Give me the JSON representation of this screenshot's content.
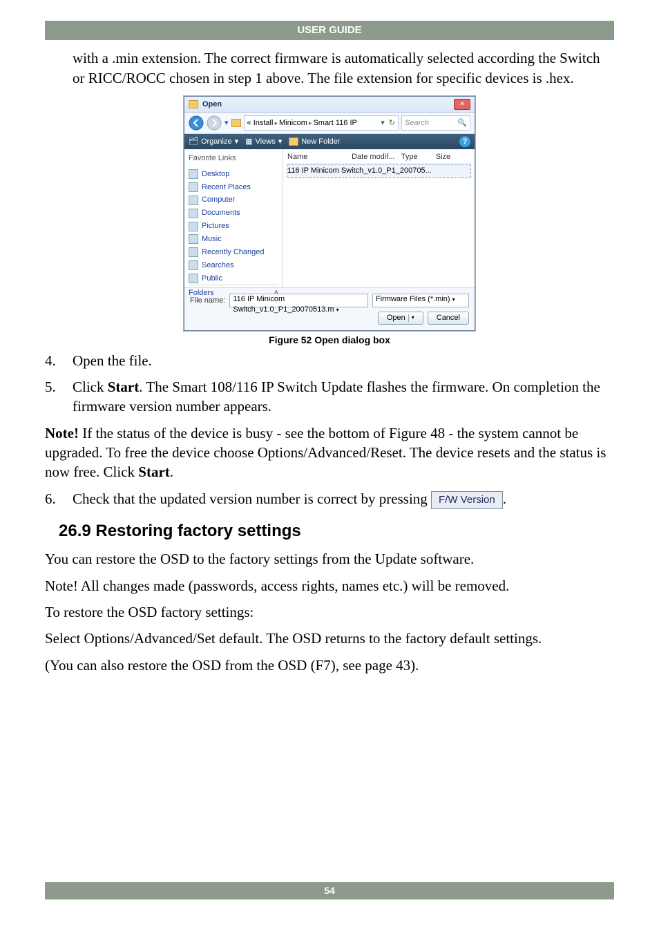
{
  "header": {
    "title": "USER GUIDE"
  },
  "intro": "with a .min extension. The correct firmware is automatically selected according the Switch or RICC/ROCC chosen in step 1 above. The file extension for specific devices is .hex.",
  "dialog": {
    "title": "Open",
    "breadcrumb": [
      "« Install",
      "Minicom",
      "Smart 116 IP"
    ],
    "search_placeholder": "Search",
    "toolbar": {
      "organize": "Organize",
      "views": "Views",
      "new_folder": "New Folder"
    },
    "favorites_header": "Favorite Links",
    "favorites": [
      "Desktop",
      "Recent Places",
      "Computer",
      "Documents",
      "Pictures",
      "Music",
      "Recently Changed",
      "Searches",
      "Public"
    ],
    "folders_label": "Folders",
    "columns": {
      "name": "Name",
      "date": "Date modif...",
      "type": "Type",
      "size": "Size"
    },
    "file_selected": "116 IP Minicom Switch_v1.0_P1_200705...",
    "filename_label": "File name:",
    "filename_value": "116 IP Minicom Switch_v1.0_P1_20070513.m",
    "filetype_value": "Firmware Files (*.min)",
    "open_btn": "Open",
    "cancel_btn": "Cancel"
  },
  "figure_caption": "Figure 52 Open dialog box",
  "steps": {
    "s4": {
      "num": "4.",
      "text": "Open the file."
    },
    "s5": {
      "num": "5.",
      "prefix": "Click ",
      "bold": "Start",
      "rest": ". The Smart 108/116 IP Switch Update flashes the firmware. On completion the firmware version number appears."
    },
    "note": {
      "label": "Note!",
      "body_a": " If the status of the device is busy - see the bottom of Figure 48 - the system cannot be upgraded. To free the device choose Options/Advanced/Reset. The device resets and the status is now free. Click ",
      "bold": "Start",
      "body_b": "."
    },
    "s6": {
      "num": "6.",
      "text": "Check that the updated version number is correct by pressing ",
      "button": "F/W Version",
      "tail": "."
    }
  },
  "section_heading": "26.9 Restoring factory settings",
  "paras": {
    "p1": "You can restore the OSD to the factory settings from the Update software.",
    "p2": "Note! All changes made (passwords, access rights, names etc.) will be removed.",
    "p3": "To restore the OSD factory settings:",
    "p4": "Select Options/Advanced/Set default. The OSD returns to the factory default settings.",
    "p5": "(You can also restore the OSD from the OSD (F7), see page 43)."
  },
  "footer": {
    "page": "54"
  }
}
